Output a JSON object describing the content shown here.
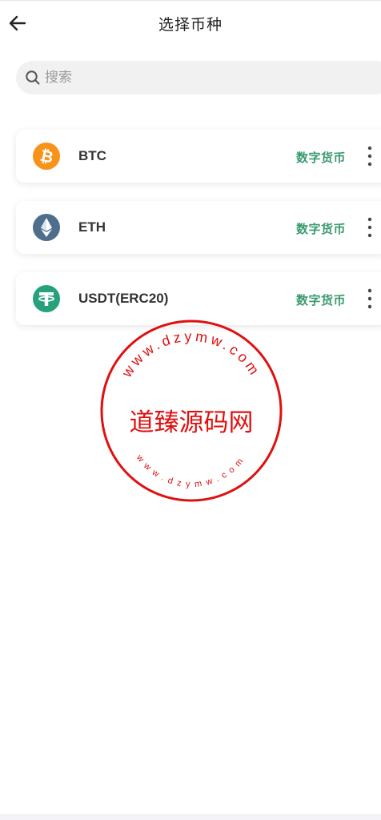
{
  "header": {
    "title": "选择币种",
    "back_icon": "arrow-left-icon"
  },
  "search": {
    "placeholder": "搜索",
    "value": "",
    "icon": "search-icon"
  },
  "coins": [
    {
      "name": "BTC",
      "type": "数字货币",
      "icon": "bitcoin-icon",
      "color": "#f7931a"
    },
    {
      "name": "ETH",
      "type": "数字货币",
      "icon": "ethereum-icon",
      "color": "#4d6e8c"
    },
    {
      "name": "USDT(ERC20)",
      "type": "数字货币",
      "icon": "tether-icon",
      "color": "#26a17b"
    }
  ],
  "watermark": {
    "text": "道臻源码网",
    "upper_ring": "www.dzymw.com",
    "lower_ring": "www.dzymw.com",
    "color": "#e01010"
  },
  "colors": {
    "accent_green": "#3a9a70",
    "search_bg": "#f1f1f1"
  }
}
